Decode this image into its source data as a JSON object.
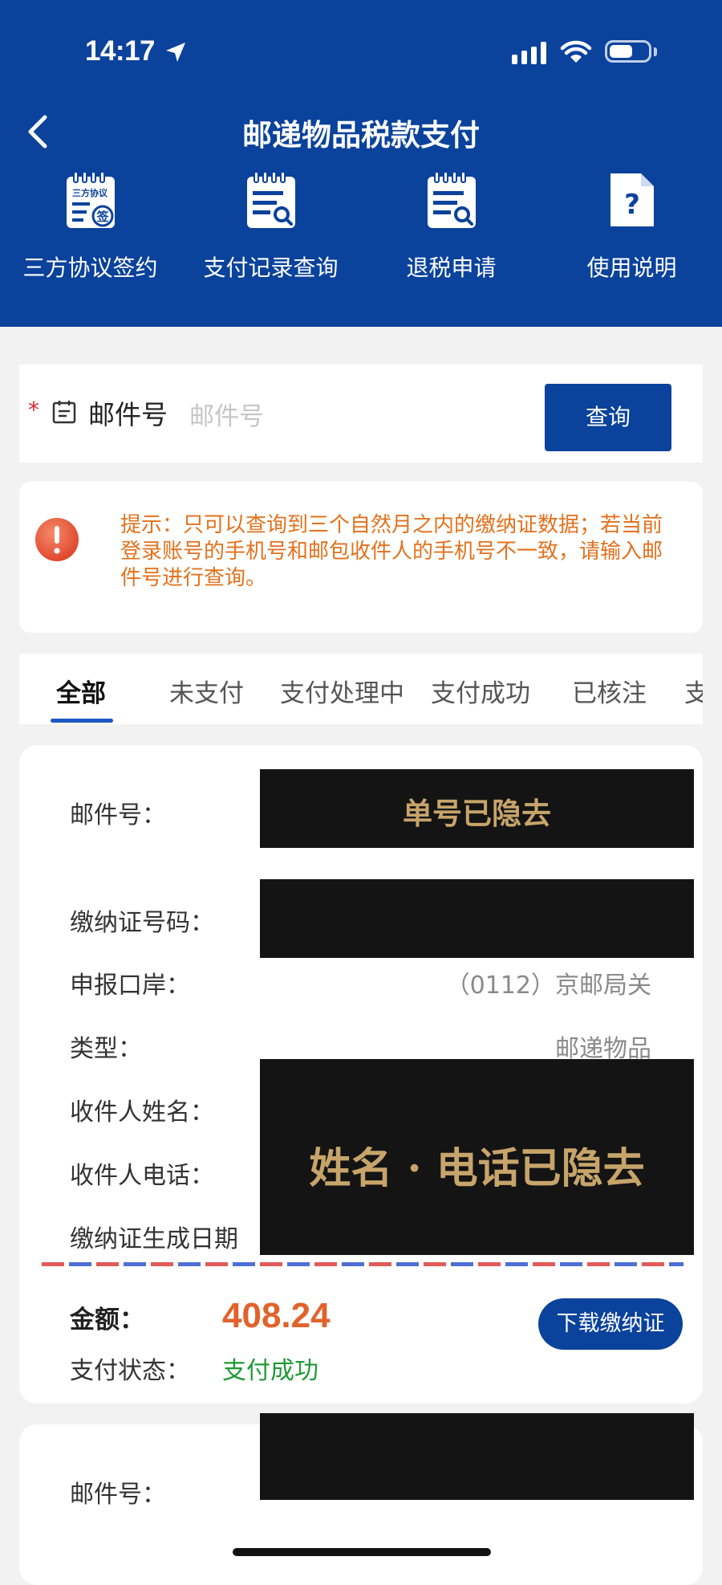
{
  "status_bar": {
    "time": "14:17"
  },
  "header": {
    "title": "邮递物品税款支付",
    "quick_actions": [
      {
        "label": "三方协议签约",
        "icon": "agreement-sign-icon",
        "badge": "三方协议",
        "stamp": "签"
      },
      {
        "label": "支付记录查询",
        "icon": "record-search-icon"
      },
      {
        "label": "退税申请",
        "icon": "refund-search-icon"
      },
      {
        "label": "使用说明",
        "icon": "help-doc-icon",
        "glyph": "?"
      }
    ]
  },
  "search": {
    "required_mark": "*",
    "label": "邮件号",
    "placeholder": "邮件号",
    "button": "查询"
  },
  "notice": {
    "text": "提示：只可以查询到三个自然月之内的缴纳证数据；若当前登录账号的手机号和邮包收件人的手机号不一致，请输入邮件号进行查询。",
    "color": "#e3711c"
  },
  "tabs": [
    "全部",
    "未支付",
    "支付处理中",
    "支付成功",
    "已核注",
    "支"
  ],
  "record": {
    "rows": [
      {
        "label": "邮件号：",
        "value": ""
      },
      {
        "label": "缴纳证号码：",
        "value": ""
      },
      {
        "label": "申报口岸：",
        "value": "（0112）京邮局关"
      },
      {
        "label": "类型：",
        "value": "邮递物品"
      },
      {
        "label": "收件人姓名：",
        "value": ""
      },
      {
        "label": "收件人电话：",
        "value": ""
      },
      {
        "label": "缴纳证生成日期",
        "value": ""
      }
    ],
    "mask_notes": {
      "tracking": "单号已隐去",
      "contact": "姓名 · 电话已隐去"
    },
    "amount_label": "金额：",
    "amount": "408.24",
    "status_label": "支付状态：",
    "status": "支付成功",
    "download_button": "下载缴纳证"
  },
  "record2": {
    "rows": [
      {
        "label": "邮件号：",
        "value": ""
      }
    ]
  },
  "colors": {
    "brand": "#0a429c",
    "amount": "#e2622b",
    "success": "#1f9a36",
    "notice": "#e3711c"
  }
}
